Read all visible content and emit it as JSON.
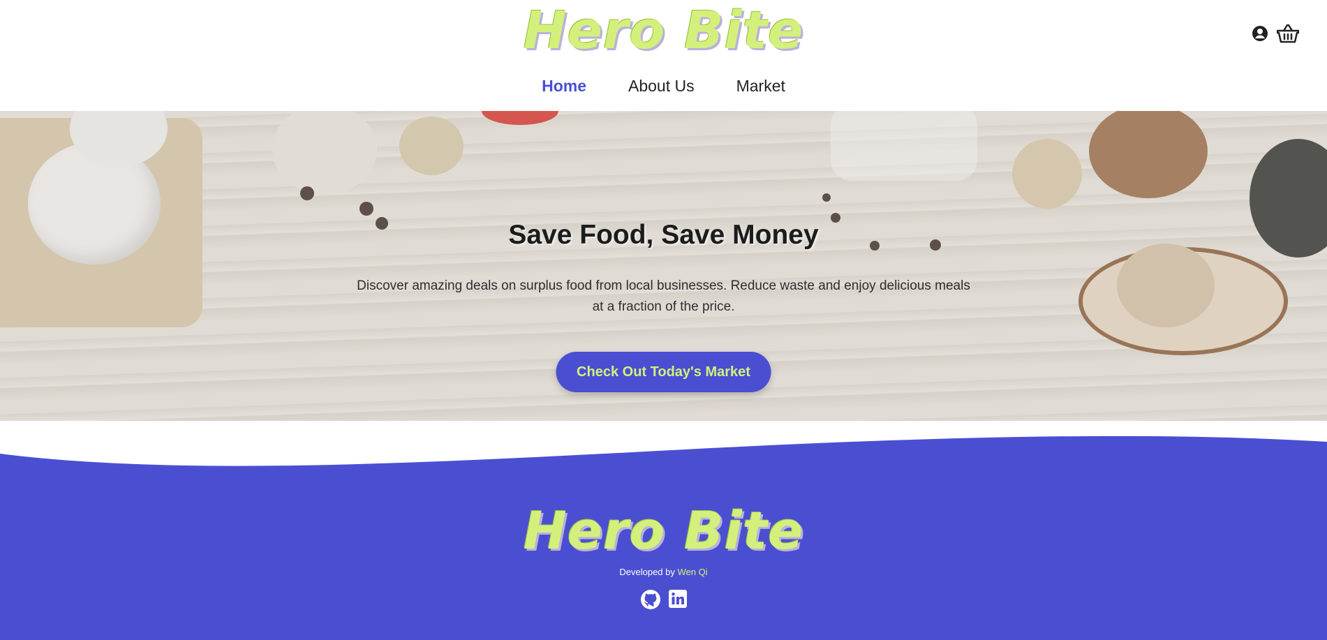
{
  "brand": {
    "name": "Hero Bite",
    "logo_color": "#d4f07c",
    "accent": "#4a4fd2"
  },
  "header": {
    "icons": [
      "user-circle-icon",
      "basket-icon"
    ],
    "nav": [
      {
        "label": "Home",
        "active": true
      },
      {
        "label": "About Us",
        "active": false
      },
      {
        "label": "Market",
        "active": false
      }
    ]
  },
  "hero": {
    "title": "Save Food, Save Money",
    "description": "Discover amazing deals on surplus food from local businesses. Reduce waste and enjoy delicious meals at a fraction of the price.",
    "cta_label": "Check Out Today's Market"
  },
  "footer": {
    "developed_by": "Developed by",
    "developer": "Wen Qi",
    "icons": [
      "github-icon",
      "linkedin-icon"
    ]
  }
}
